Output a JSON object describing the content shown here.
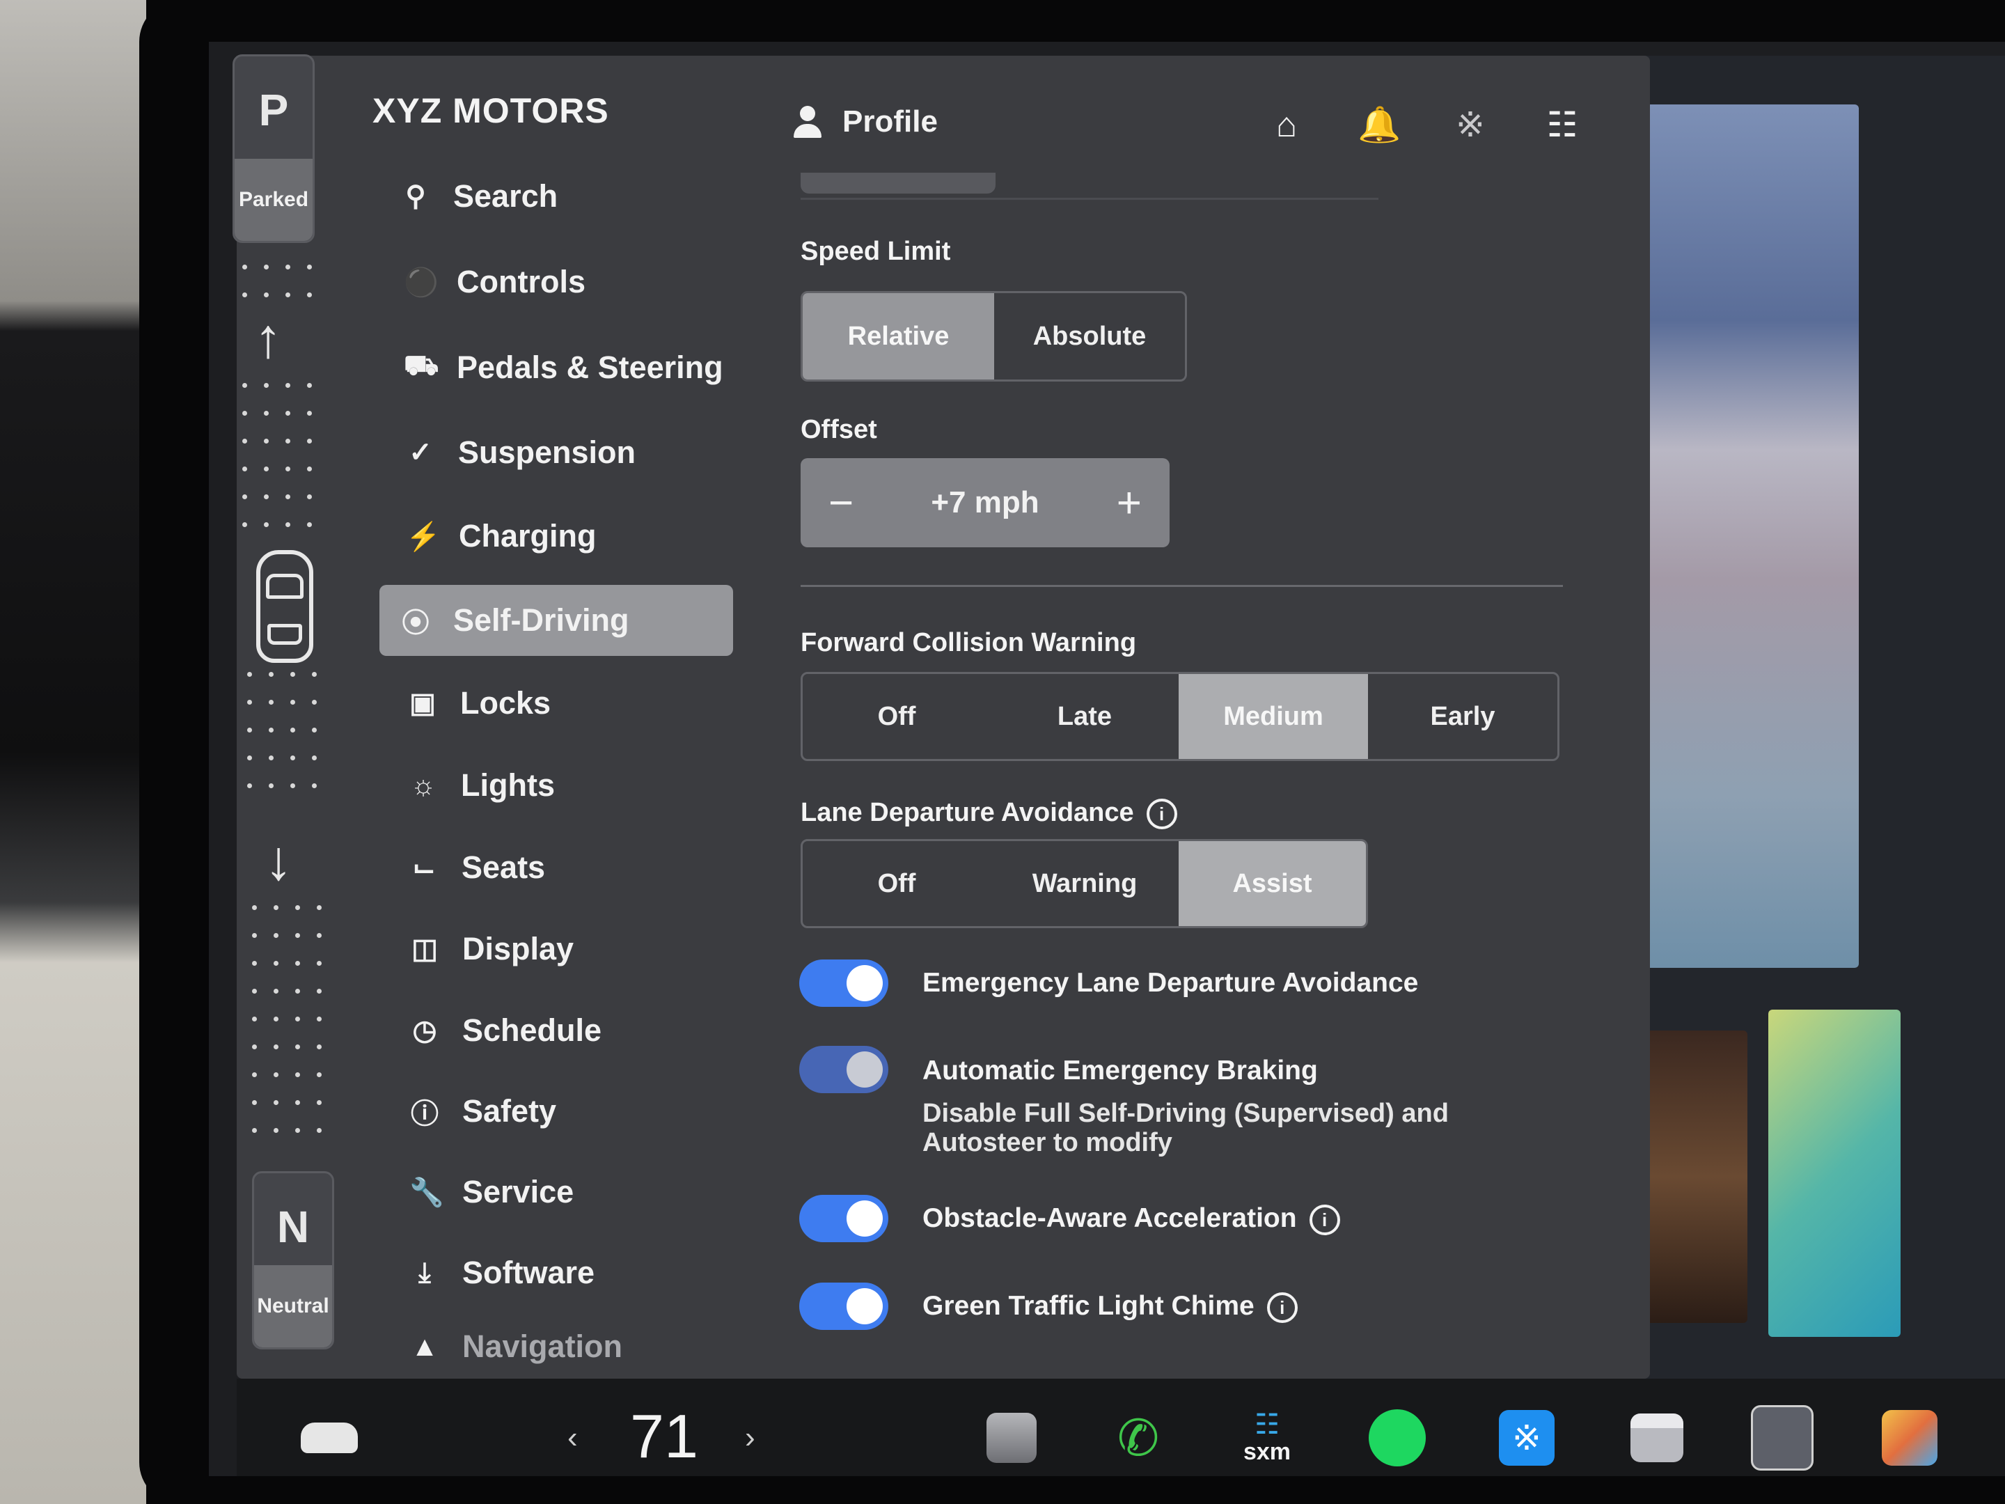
{
  "brand": "XYZ MOTORS",
  "gear": {
    "top_letter": "P",
    "top_label": "Parked",
    "bottom_letter": "N",
    "bottom_label": "Neutral"
  },
  "sidebar": {
    "items": [
      {
        "label": "Search",
        "icon": "search-icon"
      },
      {
        "label": "Controls",
        "icon": "toggle-icon"
      },
      {
        "label": "Pedals & Steering",
        "icon": "car-icon"
      },
      {
        "label": "Suspension",
        "icon": "wrench-icon"
      },
      {
        "label": "Charging",
        "icon": "bolt-icon"
      },
      {
        "label": "Self-Driving",
        "icon": "steering-wheel-icon",
        "active": true
      },
      {
        "label": "Locks",
        "icon": "lock-icon"
      },
      {
        "label": "Lights",
        "icon": "sun-icon"
      },
      {
        "label": "Seats",
        "icon": "seat-icon"
      },
      {
        "label": "Display",
        "icon": "display-icon"
      },
      {
        "label": "Schedule",
        "icon": "alarm-icon"
      },
      {
        "label": "Safety",
        "icon": "alert-icon"
      },
      {
        "label": "Service",
        "icon": "wrench-icon"
      },
      {
        "label": "Software",
        "icon": "download-icon"
      },
      {
        "label": "Navigation",
        "icon": "navigation-icon"
      }
    ]
  },
  "header": {
    "profile_label": "Profile",
    "icons": [
      "garage-icon",
      "bell-icon",
      "bluetooth-icon",
      "wifi-icon"
    ]
  },
  "speed_limit": {
    "label": "Speed Limit",
    "options": [
      "Relative",
      "Absolute"
    ],
    "selected": "Relative"
  },
  "offset": {
    "label": "Offset",
    "value": "+7 mph",
    "minus": "−",
    "plus": "+"
  },
  "forward_collision": {
    "label": "Forward Collision Warning",
    "options": [
      "Off",
      "Late",
      "Medium",
      "Early"
    ],
    "selected": "Medium"
  },
  "lane_departure": {
    "label": "Lane Departure Avoidance",
    "options": [
      "Off",
      "Warning",
      "Assist"
    ],
    "selected": "Assist"
  },
  "toggles": [
    {
      "label": "Emergency Lane Departure Avoidance",
      "on": true
    },
    {
      "label": "Automatic Emergency Braking",
      "on": true,
      "disabled": true,
      "sub": "Disable Full Self-Driving (Supervised) and Autosteer to modify"
    },
    {
      "label": "Obstacle-Aware Acceleration",
      "on": true,
      "info": true
    },
    {
      "label": "Green Traffic Light Chime",
      "on": true,
      "info": true
    }
  ],
  "dock": {
    "temperature": "71",
    "apps": [
      "car-icon",
      "autopilot-icon",
      "phone-icon",
      "siriusxm-icon",
      "spotify-icon",
      "bluetooth-icon",
      "toybox-icon",
      "calendar-icon",
      "arcade-icon"
    ],
    "sxm_label": "sxm"
  },
  "colors": {
    "toggle_on": "#3e7cf0",
    "panel_bg": "#3b3c40",
    "selected_segment": "#96979b"
  }
}
